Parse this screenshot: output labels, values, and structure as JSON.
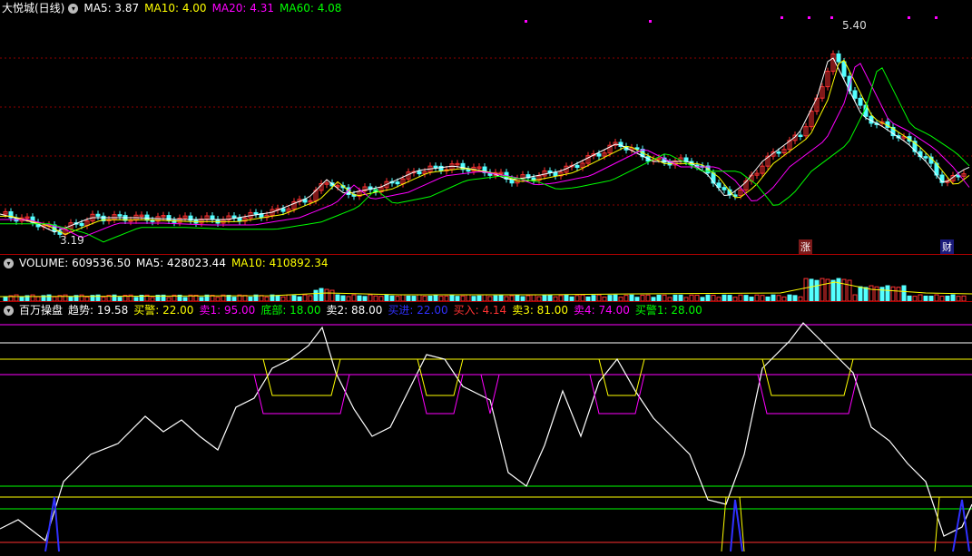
{
  "price_panel": {
    "title": "大悦城(日线)",
    "ma5": "MA5: 3.87",
    "ma10": "MA10: 4.00",
    "ma20": "MA20: 4.31",
    "ma60": "MA60: 4.08",
    "high_label": "5.40",
    "low_label": "3.19",
    "tag_zhang": "涨",
    "tag_cai": "财",
    "colors": {
      "ma5": "#ffffff",
      "ma10": "#ffff00",
      "ma20": "#ff00ff",
      "ma60": "#00ff00",
      "up": "#ff3232",
      "down": "#54ffff"
    }
  },
  "volume_panel": {
    "title": "VOLUME: 609536.50",
    "ma5": "MA5: 428023.44",
    "ma10": "MA10: 410892.34"
  },
  "indicator_panel": {
    "title": "百万操盘",
    "trend": "趋势: 19.58",
    "buy_warn": "买警: 22.00",
    "sell1": "卖1: 95.00",
    "bottom": "底部: 18.00",
    "sell2": "卖2: 88.00",
    "buy_in": "买进: 22.00",
    "buy": "买入: 4.14",
    "sell3": "卖3: 81.00",
    "sell4": "卖4: 74.00",
    "buy_warn1": "买警1: 28.00"
  }
}
